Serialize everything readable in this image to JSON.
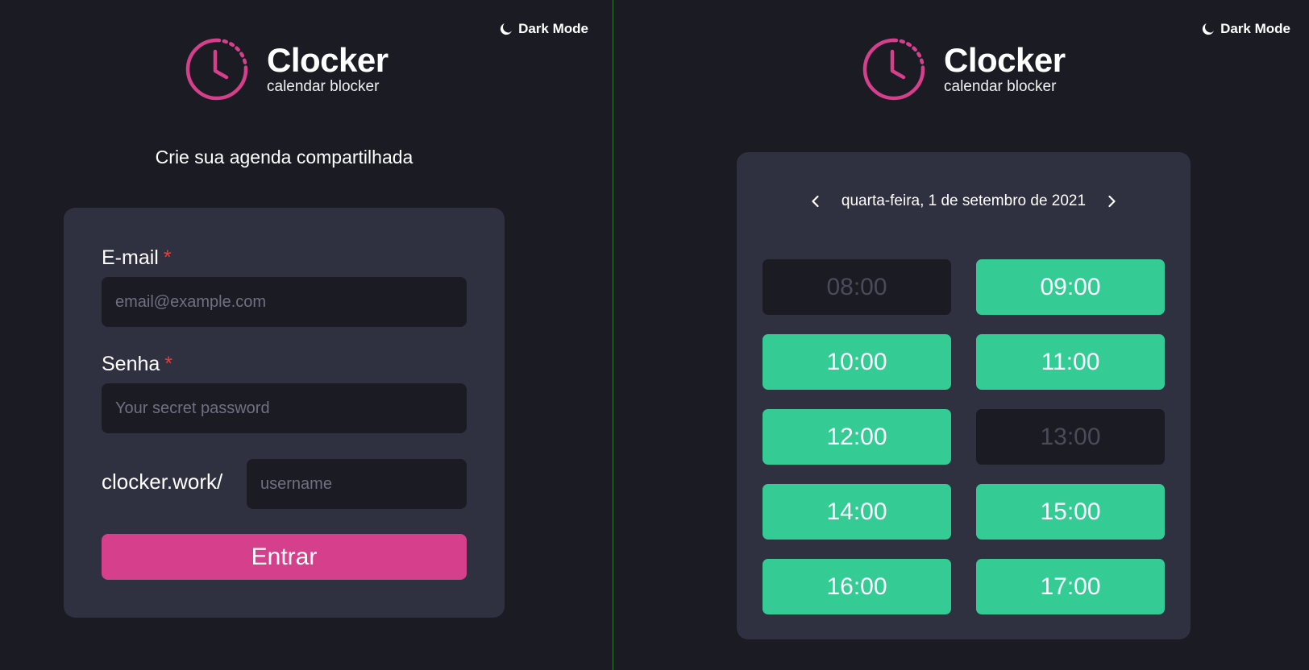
{
  "theme": {
    "background": "#1a1b23",
    "card": "#2f3040",
    "accent_pink": "#d63f8c",
    "slot_available": "#34cc94",
    "slot_blocked": "#1a1b23",
    "required_marker": "#e53e3e"
  },
  "header": {
    "dark_mode_label": "Dark Mode",
    "dark_mode_icon": "moon-icon",
    "brand_name": "Clocker",
    "brand_tagline": "calendar blocker",
    "logo_icon": "clock-icon"
  },
  "login": {
    "title": "Crie sua agenda compartilhada",
    "email_label": "E-mail",
    "email_placeholder": "email@example.com",
    "password_label": "Senha",
    "password_placeholder": "Your secret password",
    "required_marker": "*",
    "url_prefix": "clocker.work/",
    "username_placeholder": "username",
    "submit_label": "Entrar"
  },
  "schedule": {
    "date_label": "quarta-feira, 1 de setembro de 2021",
    "prev_icon": "chevron-left-icon",
    "next_icon": "chevron-right-icon",
    "slots": [
      {
        "time": "08:00",
        "available": false
      },
      {
        "time": "09:00",
        "available": true
      },
      {
        "time": "10:00",
        "available": true
      },
      {
        "time": "11:00",
        "available": true
      },
      {
        "time": "12:00",
        "available": true
      },
      {
        "time": "13:00",
        "available": false
      },
      {
        "time": "14:00",
        "available": true
      },
      {
        "time": "15:00",
        "available": true
      },
      {
        "time": "16:00",
        "available": true
      },
      {
        "time": "17:00",
        "available": true
      }
    ]
  }
}
